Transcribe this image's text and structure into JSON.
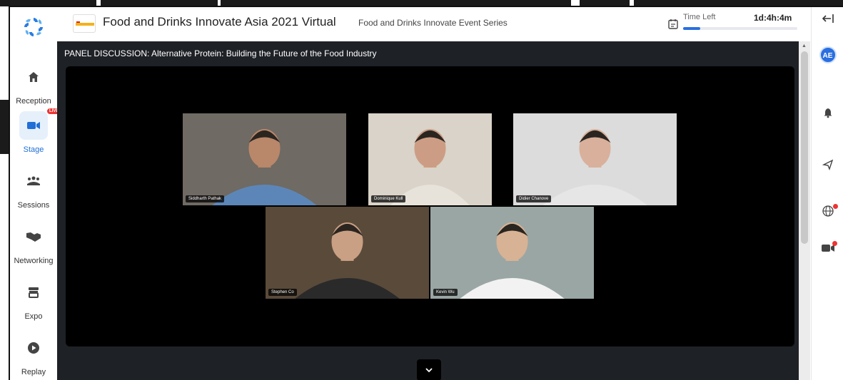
{
  "event": {
    "title": "Food and Drinks Innovate Asia 2021 Virtual",
    "series": "Food and Drinks Innovate Event Series"
  },
  "timer": {
    "label": "Time Left",
    "value": "1d:4h:4m",
    "progress_fraction": 0.15
  },
  "nav": {
    "items": [
      {
        "label": "Reception",
        "icon": "home-icon",
        "active": false
      },
      {
        "label": "Stage",
        "icon": "video-camera-icon",
        "active": true,
        "badge": "LIVE"
      },
      {
        "label": "Sessions",
        "icon": "people-icon",
        "active": false
      },
      {
        "label": "Networking",
        "icon": "handshake-icon",
        "active": false
      },
      {
        "label": "Expo",
        "icon": "booth-icon",
        "active": false
      },
      {
        "label": "Replay",
        "icon": "play-icon",
        "active": false
      }
    ]
  },
  "user": {
    "initials": "AE"
  },
  "stage": {
    "session_title": "PANEL DISCUSSION: Alternative Protein: Building the Future of the Food Industry",
    "speakers": [
      {
        "name": "Siddharth Pathak",
        "skin": "#b9876a",
        "shirt": "#5d86b8",
        "bg": "#6f6a63"
      },
      {
        "name": "Dominique Kull",
        "skin": "#cc9d84",
        "shirt": "#e8e3da",
        "bg": "#d9d3c9"
      },
      {
        "name": "Didier Chanove",
        "skin": "#d9b09b",
        "shirt": "#e6e6e6",
        "bg": "#dcdcdc"
      },
      {
        "name": "Stephen Co",
        "skin": "#c9a084",
        "shirt": "#2a2a2a",
        "bg": "#5a4a3a"
      },
      {
        "name": "Kevin Wu",
        "skin": "#d8b294",
        "shirt": "#f2f2f2",
        "bg": "#9aa6a4"
      }
    ]
  },
  "colors": {
    "accent": "#2a6fe0",
    "stage_bg": "#1e2126",
    "live": "#e33333"
  }
}
